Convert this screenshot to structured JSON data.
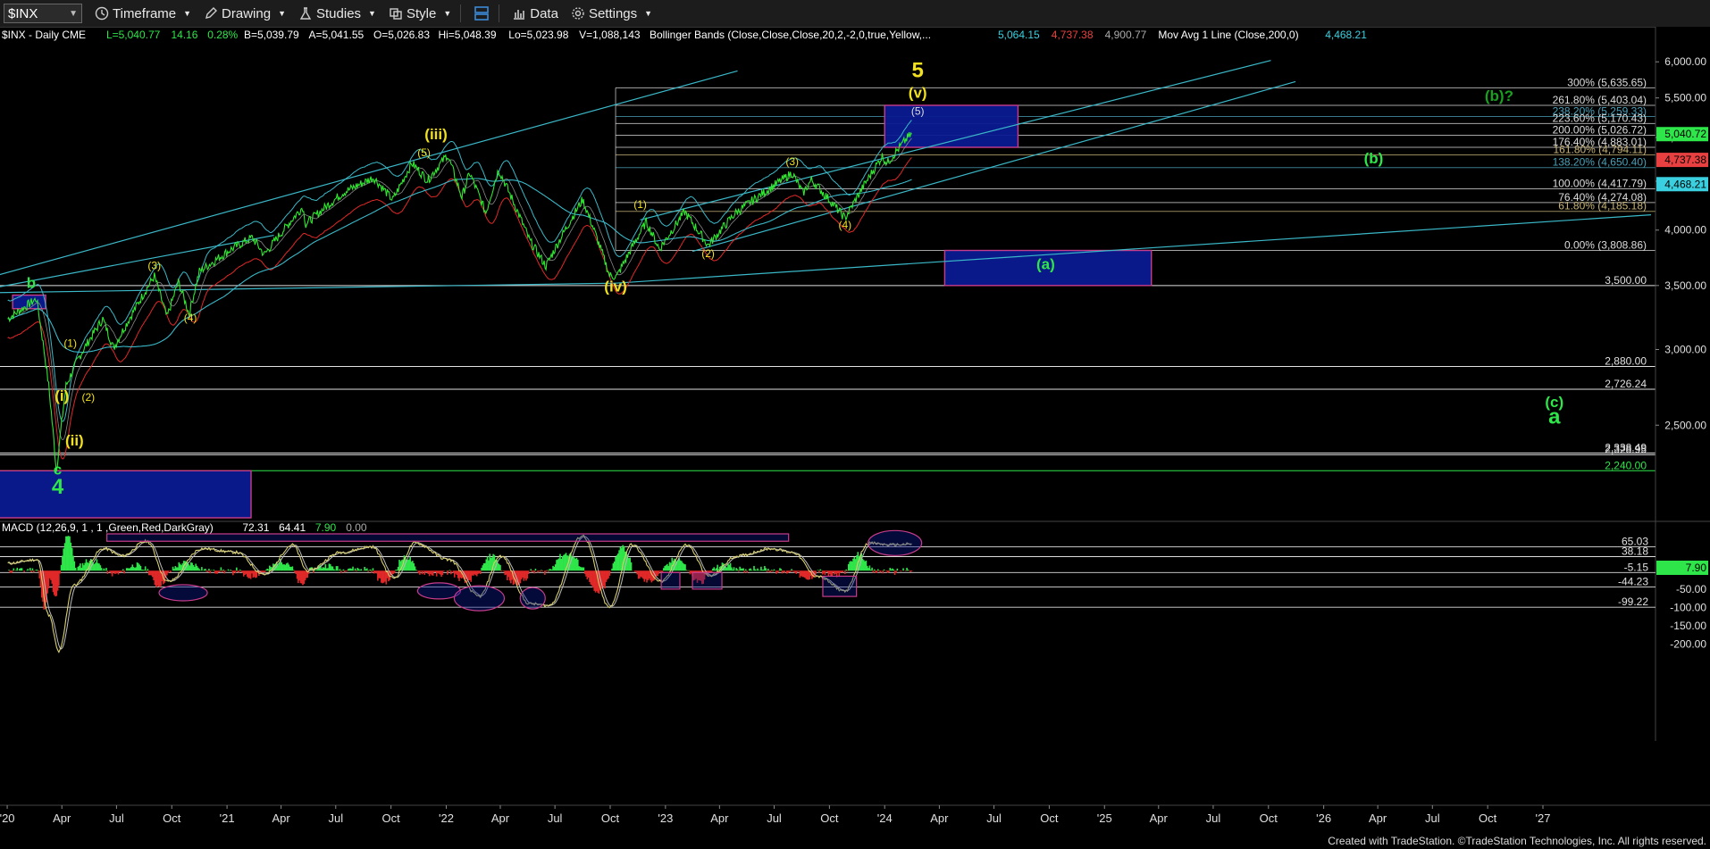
{
  "toolbar": {
    "symbol": "$INX",
    "timeframe": "Timeframe",
    "drawing": "Drawing",
    "studies": "Studies",
    "style": "Style",
    "data": "Data",
    "settings": "Settings"
  },
  "legend": {
    "main": [
      {
        "text": "$INX - Daily  CME",
        "color": "#ffffff"
      },
      {
        "text": "L=5,040.77",
        "color": "#2ee64a"
      },
      {
        "text": "14.16",
        "color": "#2ee64a"
      },
      {
        "text": "0.28%",
        "color": "#2ee64a"
      },
      {
        "text": "B=5,039.79",
        "color": "#ffffff"
      },
      {
        "text": "A=5,041.55",
        "color": "#ffffff"
      },
      {
        "text": "O=5,026.83",
        "color": "#ffffff"
      },
      {
        "text": "Hi=5,048.39",
        "color": "#ffffff"
      },
      {
        "text": "Lo=5,023.98",
        "color": "#ffffff"
      },
      {
        "text": "V=1,088,143",
        "color": "#ffffff"
      },
      {
        "text": "Bollinger Bands (Close,Close,Close,20,2,-2,0,true,Yellow,...",
        "color": "#ffffff"
      },
      {
        "text": "5,064.15",
        "color": "#3ad0e0"
      },
      {
        "text": "4,737.38",
        "color": "#e84040"
      },
      {
        "text": "4,900.77",
        "color": "#aaaaaa"
      },
      {
        "text": "Mov Avg 1 Line (Close,200,0)",
        "color": "#ffffff"
      },
      {
        "text": "4,468.21",
        "color": "#3ad0e0"
      }
    ],
    "macd": [
      {
        "text": "MACD (12,26,9, 1 , 1 ,Green,Red,DarkGray)",
        "color": "#ffffff"
      },
      {
        "text": "72.31",
        "color": "#ffffff"
      },
      {
        "text": "64.41",
        "color": "#ffffff"
      },
      {
        "text": "7.90",
        "color": "#2ee64a"
      },
      {
        "text": "0.00",
        "color": "#aaaaaa"
      }
    ]
  },
  "chart_data": {
    "type": "line",
    "symbol": "$INX",
    "interval": "Daily",
    "x_axis": {
      "ticks": [
        "'20",
        "Apr",
        "Jul",
        "Oct",
        "'21",
        "Apr",
        "Jul",
        "Oct",
        "'22",
        "Apr",
        "Jul",
        "Oct",
        "'23",
        "Apr",
        "Jul",
        "Oct",
        "'24",
        "Apr",
        "Jul",
        "Oct",
        "'25",
        "Apr",
        "Jul",
        "Oct",
        "'26",
        "Apr",
        "Jul",
        "Oct",
        "'27"
      ]
    },
    "price_axis": {
      "scale": "log",
      "ylim": [
        2000,
        6200
      ],
      "ticks": [
        "6,000.00",
        "5,500.00",
        "5,000.00",
        "4,500.00",
        "4,000.00",
        "3,500.00",
        "3,000.00",
        "2,500.00"
      ],
      "tick_values": [
        6000,
        5500,
        5000,
        4500,
        4000,
        3500,
        3000,
        2500
      ]
    },
    "price_path": [
      [
        "2020-01-02",
        3230
      ],
      [
        "2020-02-19",
        3390
      ],
      [
        "2020-03-10",
        2750
      ],
      [
        "2020-03-23",
        2237
      ],
      [
        "2020-04-08",
        2750
      ],
      [
        "2020-04-29",
        2940
      ],
      [
        "2020-06-08",
        3230
      ],
      [
        "2020-06-26",
        3010
      ],
      [
        "2020-09-02",
        3580
      ],
      [
        "2020-09-23",
        3240
      ],
      [
        "2020-10-12",
        3530
      ],
      [
        "2020-10-30",
        3270
      ],
      [
        "2020-11-16",
        3620
      ],
      [
        "2021-01-08",
        3820
      ],
      [
        "2021-02-12",
        3930
      ],
      [
        "2021-03-04",
        3770
      ],
      [
        "2021-05-07",
        4230
      ],
      [
        "2021-05-12",
        4060
      ],
      [
        "2021-07-14",
        4380
      ],
      [
        "2021-09-02",
        4540
      ],
      [
        "2021-10-04",
        4300
      ],
      [
        "2021-11-05",
        4700
      ],
      [
        "2021-12-01",
        4510
      ],
      [
        "2022-01-03",
        4796
      ],
      [
        "2022-01-27",
        4330
      ],
      [
        "2022-02-09",
        4590
      ],
      [
        "2022-03-08",
        4170
      ],
      [
        "2022-03-29",
        4630
      ],
      [
        "2022-05-20",
        3900
      ],
      [
        "2022-06-16",
        3667
      ],
      [
        "2022-08-16",
        4305
      ],
      [
        "2022-09-30",
        3585
      ],
      [
        "2022-10-12",
        3577
      ],
      [
        "2022-11-30",
        4080
      ],
      [
        "2022-12-22",
        3820
      ],
      [
        "2023-02-02",
        4180
      ],
      [
        "2023-03-13",
        3855
      ],
      [
        "2023-04-28",
        4170
      ],
      [
        "2023-06-30",
        4450
      ],
      [
        "2023-07-31",
        4590
      ],
      [
        "2023-08-18",
        4370
      ],
      [
        "2023-09-01",
        4515
      ],
      [
        "2023-10-27",
        4117
      ],
      [
        "2023-12-28",
        4780
      ],
      [
        "2024-01-05",
        4700
      ],
      [
        "2024-02-08",
        4997
      ],
      [
        "2024-02-15",
        5040
      ]
    ],
    "bollinger": {
      "upper_last": 5064.15,
      "lower_last": 4737.38,
      "mid_last": 4900.77
    },
    "moving_average_200_last": 4468.21,
    "fibonacci_levels": [
      {
        "label": "300% (5,635.65)",
        "value": 5635.65,
        "color": "#dddddd"
      },
      {
        "label": "261.80% (5,403.04)",
        "value": 5403.04,
        "color": "#dddddd"
      },
      {
        "label": "238.20% (5,259.33)",
        "value": 5259.33,
        "color": "#4aa0b8"
      },
      {
        "label": "223.60% (5,170.43)",
        "value": 5170.43,
        "color": "#dddddd"
      },
      {
        "label": "200.00% (5,026.72)",
        "value": 5026.72,
        "color": "#dddddd"
      },
      {
        "label": "176.40% (4,883.01)",
        "value": 4883.01,
        "color": "#dddddd"
      },
      {
        "label": "161.80% (4,794.11)",
        "value": 4794.11,
        "color": "#c8b478"
      },
      {
        "label": "138.20% (4,650.40)",
        "value": 4650.4,
        "color": "#4aa0b8"
      },
      {
        "label": "100.00% (4,417.79)",
        "value": 4417.79,
        "color": "#dddddd"
      },
      {
        "label": "76.40% (4,274.08)",
        "value": 4274.08,
        "color": "#dddddd"
      },
      {
        "label": "61.80% (4,185.18)",
        "value": 4185.18,
        "color": "#c8b478"
      },
      {
        "label": "0.00% (3,808.86)",
        "value": 3808.86,
        "color": "#dddddd"
      }
    ],
    "horizontal_levels": [
      {
        "label": "3,500.00",
        "value": 3500
      },
      {
        "label": "2,880.00",
        "value": 2880
      },
      {
        "label": "2,726.24",
        "value": 2726.24
      },
      {
        "label": "2,338.49",
        "value": 2338
      },
      {
        "label": "2,328.95",
        "value": 2328
      },
      {
        "label": "2,240.00",
        "value": 2240,
        "color": "#2ee64a"
      }
    ],
    "price_badges": [
      {
        "label": "5,040.72",
        "value": 5040.72,
        "color": "#2ee64a"
      },
      {
        "label": "4,737.38",
        "value": 4737.38,
        "color": "#e84040"
      },
      {
        "label": "4,468.21",
        "value": 4468.21,
        "color": "#3ad0e0"
      }
    ],
    "target_boxes": [
      {
        "name": "upper-target",
        "from": "2024-01-01",
        "to": "2024-08-10",
        "low": 4883,
        "high": 5403
      },
      {
        "name": "a-target",
        "from": "2024-04-10",
        "to": "2025-03-20",
        "low": 3500,
        "high": 3808.86
      },
      {
        "name": "b-box",
        "from": "2020-01-10",
        "to": "2020-03-05",
        "low": 3310,
        "high": 3420
      },
      {
        "name": "c4-box",
        "from": "2019-12-10",
        "to": "2021-02-10",
        "low": 2000,
        "high": 2240
      }
    ],
    "wave_labels": [
      {
        "text": "5",
        "date": "2024-02-25",
        "value": 5780,
        "color": "#f0e020",
        "size": "big"
      },
      {
        "text": "(v)",
        "date": "2024-02-25",
        "value": 5500,
        "color": "#f0e020",
        "size": "mid"
      },
      {
        "text": "(5)",
        "date": "2024-02-25",
        "value": 5280,
        "color": "#dddddd",
        "size": "small"
      },
      {
        "text": "(iii)",
        "date": "2021-12-15",
        "value": 4980,
        "color": "#f0e020",
        "size": "mid"
      },
      {
        "text": "(5)",
        "date": "2021-11-25",
        "value": 4780,
        "color": "#f0e020",
        "size": "small"
      },
      {
        "text": "(iv)",
        "date": "2022-10-10",
        "value": 3450,
        "color": "#f0e020",
        "size": "mid"
      },
      {
        "text": "(1)",
        "date": "2022-11-20",
        "value": 4220,
        "color": "#f0e020",
        "size": "small"
      },
      {
        "text": "(2)",
        "date": "2023-03-13",
        "value": 3750,
        "color": "#f0e020",
        "size": "small"
      },
      {
        "text": "(3)",
        "date": "2023-07-31",
        "value": 4680,
        "color": "#f0e020",
        "size": "small"
      },
      {
        "text": "(4)",
        "date": "2023-10-27",
        "value": 4015,
        "color": "#f0e020",
        "size": "small"
      },
      {
        "text": "(3)",
        "date": "2020-09-02",
        "value": 3640,
        "color": "#f0e020",
        "size": "small"
      },
      {
        "text": "(4)",
        "date": "2020-11-01",
        "value": 3210,
        "color": "#f0e020",
        "size": "small"
      },
      {
        "text": "(1)",
        "date": "2020-04-15",
        "value": 3020,
        "color": "#f0e020",
        "size": "small"
      },
      {
        "text": "(2)",
        "date": "2020-05-15",
        "value": 2650,
        "color": "#f0e020",
        "size": "small"
      },
      {
        "text": "(i)",
        "date": "2020-04-01",
        "value": 2650,
        "color": "#f0e020",
        "size": "mid"
      },
      {
        "text": "(ii)",
        "date": "2020-04-22",
        "value": 2380,
        "color": "#f0e020",
        "size": "mid"
      },
      {
        "text": "b",
        "date": "2020-02-10",
        "value": 3480,
        "color": "#2ee64a",
        "size": "mid"
      },
      {
        "text": "c",
        "date": "2020-03-25",
        "value": 2220,
        "color": "#2ee64a",
        "size": "mid"
      },
      {
        "text": "4",
        "date": "2020-03-25",
        "value": 2120,
        "color": "#2ee64a",
        "size": "big"
      },
      {
        "text": "(b)?",
        "date": "2026-10-20",
        "value": 5460,
        "color": "#1aa020",
        "size": "mid"
      },
      {
        "text": "(b)",
        "date": "2026-03-25",
        "value": 4700,
        "color": "#2ee64a",
        "size": "mid"
      },
      {
        "text": "(a)",
        "date": "2024-09-25",
        "value": 3640,
        "color": "#2ee64a",
        "size": "mid"
      },
      {
        "text": "(c)",
        "date": "2027-01-20",
        "value": 2610,
        "color": "#2ee64a",
        "size": "mid"
      },
      {
        "text": "a",
        "date": "2027-01-20",
        "value": 2510,
        "color": "#2ee64a",
        "size": "big"
      }
    ],
    "trendlines": [
      {
        "color": "#3ab8c8",
        "from": [
          "2019-12-20",
          3490
        ],
        "to": [
          "2021-03-20",
          3950
        ]
      },
      {
        "color": "#3ab8c8",
        "from": [
          "2022-10-10",
          3520
        ],
        "to": [
          "2027-06-30",
          4150
        ]
      },
      {
        "color": "#3ab8c8",
        "from": [
          "2019-12-10",
          3440
        ],
        "to": [
          "2022-10-10",
          3520
        ]
      },
      {
        "color": "#3ab8c8",
        "from": [
          "2019-12-10",
          3580
        ],
        "to": [
          "2023-05-01",
          5870
        ]
      },
      {
        "color": "#3ab8c8",
        "from": [
          "2022-11-20",
          4100
        ],
        "to": [
          "2025-10-05",
          6020
        ]
      },
      {
        "color": "#3ab8c8",
        "from": [
          "2023-02-15",
          3800
        ],
        "to": [
          "2025-11-15",
          5720
        ]
      }
    ],
    "macd_axis": {
      "ylim": [
        -225,
        100
      ],
      "ticks": [
        "-50.00",
        "-100.00",
        "-150.00",
        "-200.00"
      ],
      "tick_values": [
        -50,
        -100,
        -150,
        -200
      ],
      "levels": [
        {
          "label": "65.03",
          "value": 65.03
        },
        {
          "label": "38.18",
          "value": 38.18
        },
        {
          "label": "-5.15",
          "value": -5.15
        },
        {
          "label": "-44.23",
          "value": -44.23
        },
        {
          "label": "-99.22",
          "value": -99.22
        }
      ],
      "badge": {
        "label": "7.90",
        "value": 7.9
      }
    },
    "macd_path": [
      [
        "2020-01-02",
        20
      ],
      [
        "2020-02-20",
        30
      ],
      [
        "2020-03-10",
        -120
      ],
      [
        "2020-03-27",
        -220
      ],
      [
        "2020-04-20",
        -40
      ],
      [
        "2020-06-10",
        60
      ],
      [
        "2020-07-10",
        40
      ],
      [
        "2020-08-20",
        80
      ],
      [
        "2020-09-25",
        -30
      ],
      [
        "2020-11-20",
        60
      ],
      [
        "2021-01-15",
        50
      ],
      [
        "2021-03-05",
        -10
      ],
      [
        "2021-04-20",
        70
      ],
      [
        "2021-05-15",
        0
      ],
      [
        "2021-07-10",
        50
      ],
      [
        "2021-08-30",
        65
      ],
      [
        "2021-10-05",
        -20
      ],
      [
        "2021-11-10",
        75
      ],
      [
        "2022-01-05",
        30
      ],
      [
        "2022-02-25",
        -70
      ],
      [
        "2022-04-01",
        40
      ],
      [
        "2022-05-20",
        -90
      ],
      [
        "2022-06-20",
        -95
      ],
      [
        "2022-08-16",
        95
      ],
      [
        "2022-09-30",
        -100
      ],
      [
        "2022-11-05",
        70
      ],
      [
        "2022-12-25",
        -30
      ],
      [
        "2023-02-05",
        70
      ],
      [
        "2023-03-15",
        -15
      ],
      [
        "2023-05-01",
        40
      ],
      [
        "2023-06-25",
        60
      ],
      [
        "2023-08-01",
        50
      ],
      [
        "2023-09-10",
        -15
      ],
      [
        "2023-10-27",
        -55
      ],
      [
        "2023-12-05",
        75
      ],
      [
        "2024-01-10",
        70
      ],
      [
        "2024-02-15",
        72
      ]
    ],
    "macd_signal_last": 64.41,
    "macd_histogram_last": 7.9
  },
  "footer": "Created with TradeStation. ©TradeStation Technologies, Inc. All rights reserved."
}
